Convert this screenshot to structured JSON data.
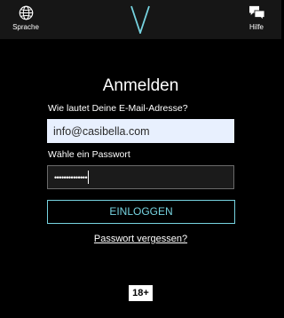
{
  "header": {
    "language_label": "Sprache",
    "language_icon": "globe-icon",
    "help_label": "Hilfe",
    "help_icon": "chat-bubbles-icon",
    "logo_icon": "v-logo-icon"
  },
  "login": {
    "title": "Anmelden",
    "email_label": "Wie lautet Deine E-Mail-Adresse?",
    "email_value": "info@casibella.com",
    "password_label": "Wähle ein Passwort",
    "password_masked": "••••••••••••••",
    "submit_label": "EINLOGGEN",
    "forgot_label": "Passwort vergessen?"
  },
  "footer": {
    "age_badge": "18+"
  },
  "colors": {
    "background": "#000000",
    "topbar": "#161616",
    "accent": "#76d3e0",
    "email_field_bg": "#e8f0fe"
  }
}
